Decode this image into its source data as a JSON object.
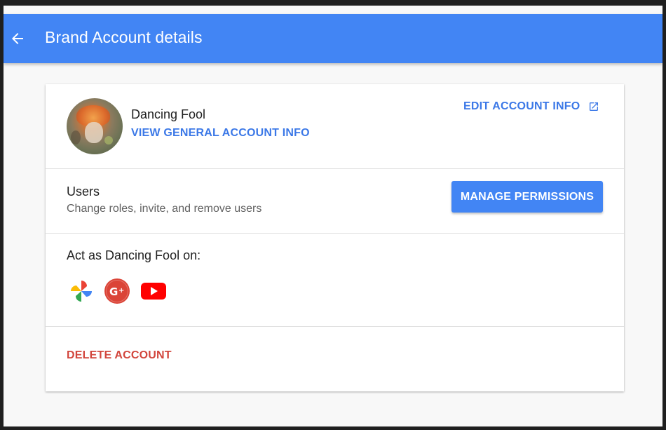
{
  "header": {
    "title": "Brand Account details",
    "back_icon": "arrow-left-icon",
    "background_color": "#4285f4"
  },
  "account": {
    "name": "Dancing Fool",
    "view_general_label": "VIEW GENERAL ACCOUNT INFO",
    "edit_label": "EDIT ACCOUNT INFO",
    "edit_icon": "open-in-new-icon"
  },
  "users": {
    "title": "Users",
    "subtitle": "Change roles, invite, and remove users",
    "manage_label": "MANAGE PERMISSIONS"
  },
  "act_as": {
    "label": "Act as Dancing Fool on:",
    "services": [
      {
        "name": "Google Photos",
        "icon": "google-photos-icon"
      },
      {
        "name": "Google+",
        "icon": "google-plus-icon"
      },
      {
        "name": "YouTube",
        "icon": "youtube-icon"
      }
    ]
  },
  "danger": {
    "delete_label": "DELETE ACCOUNT",
    "color": "#d2453c"
  },
  "colors": {
    "link_blue": "#3b78e7",
    "button_blue": "#4285f4"
  }
}
